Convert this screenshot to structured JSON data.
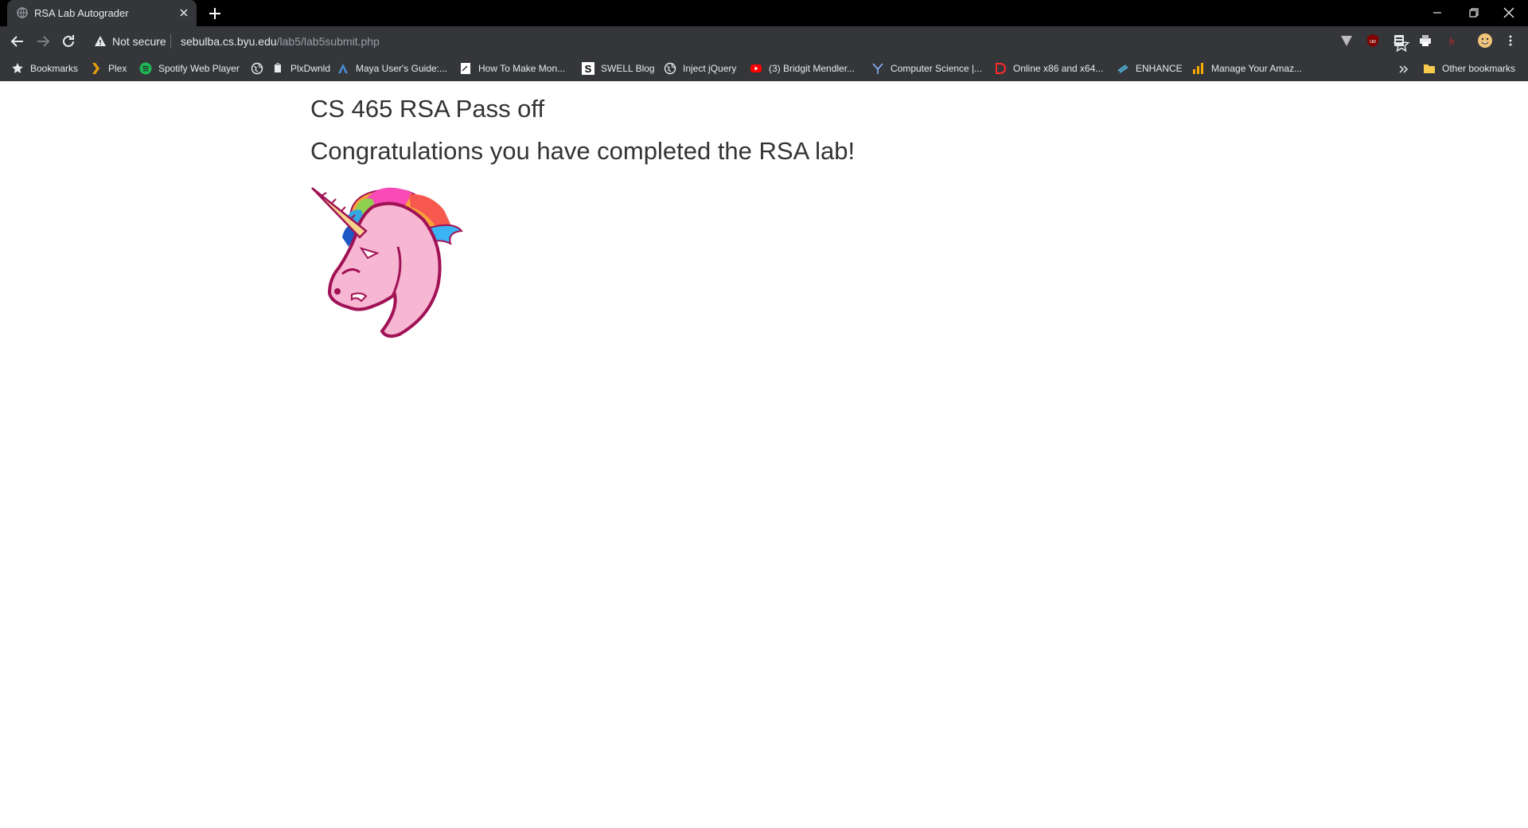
{
  "tab": {
    "title": "RSA Lab Autograder"
  },
  "address_bar": {
    "security_label": "Not secure",
    "url_host": "sebulba.cs.byu.edu",
    "url_path": "/lab5/lab5submit.php"
  },
  "bookmarks": [
    {
      "label": "Bookmarks",
      "icon": "star-icon"
    },
    {
      "label": "Plex",
      "icon": "plex-icon"
    },
    {
      "label": "Spotify Web Player",
      "icon": "spotify-icon"
    },
    {
      "label": "",
      "icon": "globe-icon"
    },
    {
      "label": "PlxDwnld",
      "icon": "bookmarklet-icon"
    },
    {
      "label": "Maya User's Guide:...",
      "icon": "autodesk-icon"
    },
    {
      "label": "How To Make Mon...",
      "icon": "page-icon"
    },
    {
      "label": "SWELL Blog",
      "icon": "swell-icon"
    },
    {
      "label": "Inject jQuery",
      "icon": "globe-icon"
    },
    {
      "label": "(3) Bridgit Mendler...",
      "icon": "youtube-icon"
    },
    {
      "label": "Computer Science |...",
      "icon": "y-icon"
    },
    {
      "label": "Online x86 and x64...",
      "icon": "d-icon"
    },
    {
      "label": "ENHANCE",
      "icon": "enhance-icon"
    },
    {
      "label": "Manage Your Amaz...",
      "icon": "chart-icon"
    }
  ],
  "other_bookmarks": {
    "label": "Other bookmarks",
    "icon": "folder-icon"
  },
  "page": {
    "heading": "CS 465 RSA Pass off",
    "message": "Congratulations you have completed the RSA lab!"
  },
  "colors": {
    "frame": "#000000",
    "toolbar": "#35363a",
    "text": "#e8eaed",
    "page_text": "#333333",
    "unicorn_pink": "#f7b6d2",
    "unicorn_outline": "#a01255"
  }
}
